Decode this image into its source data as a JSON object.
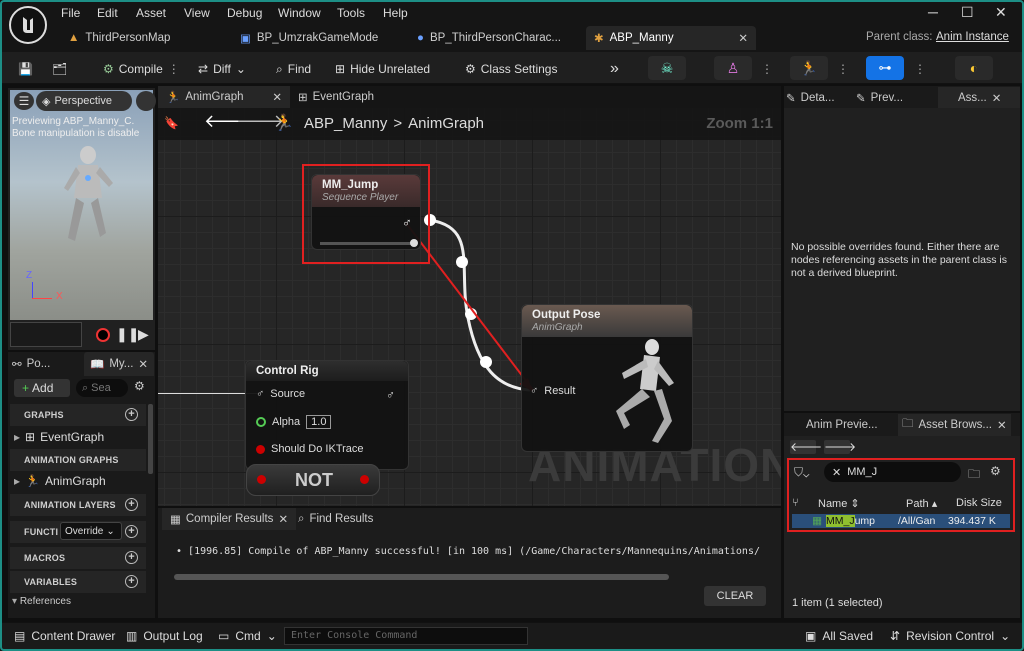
{
  "menu": [
    "File",
    "Edit",
    "Asset",
    "View",
    "Debug",
    "Window",
    "Tools",
    "Help"
  ],
  "tabs": [
    {
      "label": "ThirdPersonMap"
    },
    {
      "label": "BP_UmzrakGameMode"
    },
    {
      "label": "BP_ThirdPersonCharac..."
    },
    {
      "label": "ABP_Manny"
    }
  ],
  "parent_class": {
    "label": "Parent class:",
    "value": "Anim Instance"
  },
  "toolbar": {
    "compile": "Compile",
    "diff": "Diff",
    "find": "Find",
    "hide_unrelated": "Hide Unrelated",
    "class_settings": "Class Settings"
  },
  "viewport": {
    "perspective": "Perspective",
    "line1": "Previewing ABP_Manny_C.",
    "line2": "Bone manipulation is disable"
  },
  "graph_tabs": {
    "anim": "AnimGraph",
    "event": "EventGraph"
  },
  "breadcrumb": {
    "root": "ABP_Manny",
    "sep": ">",
    "child": "AnimGraph"
  },
  "zoom": "Zoom 1:1",
  "nodes": {
    "mm_jump": {
      "title": "MM_Jump",
      "sub": "Sequence Player"
    },
    "output": {
      "title": "Output Pose",
      "sub": "AnimGraph",
      "pin": "Result"
    },
    "control_rig": {
      "title": "Control Rig",
      "source": "Source",
      "alpha": "Alpha",
      "alpha_val": "1.0",
      "ik": "Should Do IKTrace"
    },
    "not": "NOT"
  },
  "watermark": "ANIMATION",
  "mybp": {
    "tab1": "Po...",
    "tab2": "My...",
    "add": "Add",
    "search_placeholder": "Sea",
    "graphs": "GRAPHS",
    "event_graph": "EventGraph",
    "anim_graphs": "ANIMATION GRAPHS",
    "anim_graph": "AnimGraph",
    "anim_layers": "ANIMATION LAYERS",
    "functions": "FUNCTI",
    "override": "Override",
    "macros": "MACROS",
    "variables": "VARIABLES",
    "references": "References"
  },
  "compiler": {
    "tab": "Compiler Results",
    "find": "Find Results",
    "message": "[1996.85] Compile of ABP_Manny successful! [in 100 ms] (/Game/Characters/Mannequins/Animations/",
    "clear": "CLEAR"
  },
  "right": {
    "tab_details": "Deta...",
    "tab_preview": "Prev...",
    "tab_asset": "Ass...",
    "overrides_msg": "No possible overrides found. Either there are nodes referencing assets in the parent class is not a derived blueprint."
  },
  "asset_browser": {
    "tab1": "Anim Previe...",
    "tab2": "Asset Brows...",
    "search": "MM_J",
    "col_name": "Name",
    "col_path": "Path",
    "col_size": "Disk Size",
    "row": {
      "name_hl": "MM_J",
      "name_rest": "ump",
      "path": "/All/Gan",
      "size": "394.437 K"
    },
    "footer": "1 item (1 selected)"
  },
  "status": {
    "content_drawer": "Content Drawer",
    "output_log": "Output Log",
    "cmd": "Cmd",
    "console_placeholder": "Enter Console Command",
    "all_saved": "All Saved",
    "revision": "Revision Control"
  },
  "colors": {
    "accent": "#1d8f86",
    "highlight": "#e02020",
    "select_row": "#2a4f7a",
    "search_hl": "#8fbf2f"
  }
}
